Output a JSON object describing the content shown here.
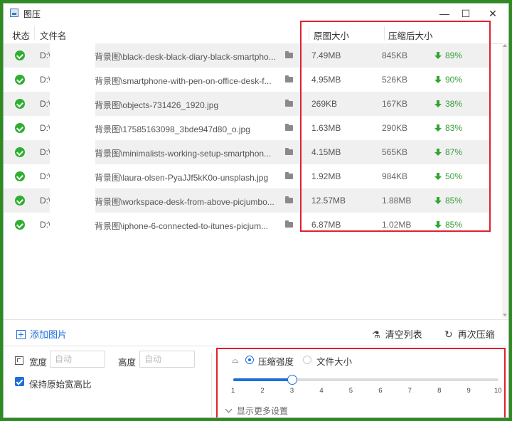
{
  "app": {
    "title": "图压"
  },
  "window_controls": {
    "minimize": "—",
    "maximize": "☐",
    "close": "✕"
  },
  "table": {
    "headers": {
      "status": "状态",
      "filename": "文件名",
      "original_size": "原图大小",
      "compressed_size": "压缩后大小"
    },
    "rows": [
      {
        "drive": "D:\\",
        "name": "背景图\\black-desk-black-diary-black-smartpho...",
        "original": "7.49MB",
        "compressed": "845KB",
        "ratio": "89%"
      },
      {
        "drive": "D:\\",
        "name": "背景图\\smartphone-with-pen-on-office-desk-f...",
        "original": "4.95MB",
        "compressed": "526KB",
        "ratio": "90%"
      },
      {
        "drive": "D:\\",
        "name": "背景图\\objects-731426_1920.jpg",
        "original": "269KB",
        "compressed": "167KB",
        "ratio": "38%"
      },
      {
        "drive": "D:\\",
        "name": "背景图\\17585163098_3bde947d80_o.jpg",
        "original": "1.63MB",
        "compressed": "290KB",
        "ratio": "83%"
      },
      {
        "drive": "D:\\",
        "name": "背景图\\minimalists-working-setup-smartphon...",
        "original": "4.15MB",
        "compressed": "565KB",
        "ratio": "87%"
      },
      {
        "drive": "D:\\",
        "name": "背景图\\laura-olsen-PyaJJf5kK0o-unsplash.jpg",
        "original": "1.92MB",
        "compressed": "984KB",
        "ratio": "50%"
      },
      {
        "drive": "D:\\",
        "name": "背景图\\workspace-desk-from-above-picjumbo...",
        "original": "12.57MB",
        "compressed": "1.88MB",
        "ratio": "85%"
      },
      {
        "drive": "D:\\",
        "name": "背景图\\iphone-6-connected-to-itunes-picjum...",
        "original": "6.87MB",
        "compressed": "1.02MB",
        "ratio": "85%"
      }
    ]
  },
  "toolbar": {
    "add": "添加图片",
    "clear": "清空列表",
    "recompress": "再次压缩"
  },
  "settings": {
    "width_label": "宽度",
    "width_placeholder": "自动",
    "height_label": "高度",
    "height_placeholder": "自动",
    "keep_ratio_label": "保持原始宽高比",
    "keep_ratio_checked": true,
    "mode_strength_label": "压缩强度",
    "mode_size_label": "文件大小",
    "mode_selected": "strength",
    "slider_value": 3,
    "slider_min": 1,
    "slider_max": 10,
    "slider_ticks": [
      "1",
      "2",
      "3",
      "4",
      "5",
      "6",
      "7",
      "8",
      "9",
      "10"
    ],
    "more_settings": "显示更多设置"
  },
  "colors": {
    "accent": "#1e6fd9",
    "success": "#2fae2f",
    "highlight": "#e0202e"
  }
}
